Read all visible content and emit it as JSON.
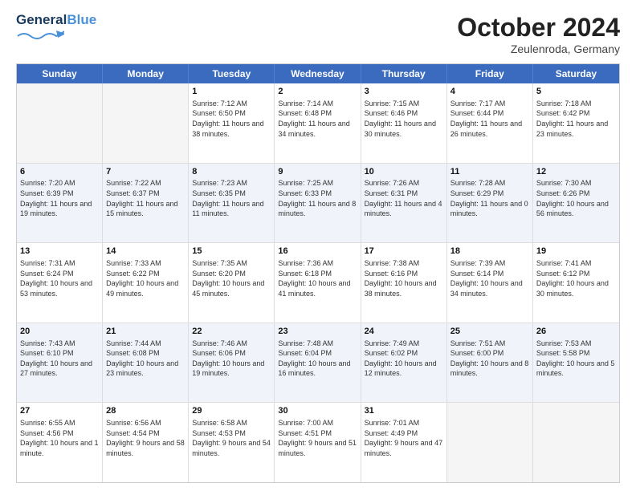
{
  "header": {
    "logo_line1": "General",
    "logo_line2": "Blue",
    "month": "October 2024",
    "location": "Zeulenroda, Germany"
  },
  "days_of_week": [
    "Sunday",
    "Monday",
    "Tuesday",
    "Wednesday",
    "Thursday",
    "Friday",
    "Saturday"
  ],
  "weeks": [
    [
      {
        "day": "",
        "info": ""
      },
      {
        "day": "",
        "info": ""
      },
      {
        "day": "1",
        "info": "Sunrise: 7:12 AM\nSunset: 6:50 PM\nDaylight: 11 hours and 38 minutes."
      },
      {
        "day": "2",
        "info": "Sunrise: 7:14 AM\nSunset: 6:48 PM\nDaylight: 11 hours and 34 minutes."
      },
      {
        "day": "3",
        "info": "Sunrise: 7:15 AM\nSunset: 6:46 PM\nDaylight: 11 hours and 30 minutes."
      },
      {
        "day": "4",
        "info": "Sunrise: 7:17 AM\nSunset: 6:44 PM\nDaylight: 11 hours and 26 minutes."
      },
      {
        "day": "5",
        "info": "Sunrise: 7:18 AM\nSunset: 6:42 PM\nDaylight: 11 hours and 23 minutes."
      }
    ],
    [
      {
        "day": "6",
        "info": "Sunrise: 7:20 AM\nSunset: 6:39 PM\nDaylight: 11 hours and 19 minutes."
      },
      {
        "day": "7",
        "info": "Sunrise: 7:22 AM\nSunset: 6:37 PM\nDaylight: 11 hours and 15 minutes."
      },
      {
        "day": "8",
        "info": "Sunrise: 7:23 AM\nSunset: 6:35 PM\nDaylight: 11 hours and 11 minutes."
      },
      {
        "day": "9",
        "info": "Sunrise: 7:25 AM\nSunset: 6:33 PM\nDaylight: 11 hours and 8 minutes."
      },
      {
        "day": "10",
        "info": "Sunrise: 7:26 AM\nSunset: 6:31 PM\nDaylight: 11 hours and 4 minutes."
      },
      {
        "day": "11",
        "info": "Sunrise: 7:28 AM\nSunset: 6:29 PM\nDaylight: 11 hours and 0 minutes."
      },
      {
        "day": "12",
        "info": "Sunrise: 7:30 AM\nSunset: 6:26 PM\nDaylight: 10 hours and 56 minutes."
      }
    ],
    [
      {
        "day": "13",
        "info": "Sunrise: 7:31 AM\nSunset: 6:24 PM\nDaylight: 10 hours and 53 minutes."
      },
      {
        "day": "14",
        "info": "Sunrise: 7:33 AM\nSunset: 6:22 PM\nDaylight: 10 hours and 49 minutes."
      },
      {
        "day": "15",
        "info": "Sunrise: 7:35 AM\nSunset: 6:20 PM\nDaylight: 10 hours and 45 minutes."
      },
      {
        "day": "16",
        "info": "Sunrise: 7:36 AM\nSunset: 6:18 PM\nDaylight: 10 hours and 41 minutes."
      },
      {
        "day": "17",
        "info": "Sunrise: 7:38 AM\nSunset: 6:16 PM\nDaylight: 10 hours and 38 minutes."
      },
      {
        "day": "18",
        "info": "Sunrise: 7:39 AM\nSunset: 6:14 PM\nDaylight: 10 hours and 34 minutes."
      },
      {
        "day": "19",
        "info": "Sunrise: 7:41 AM\nSunset: 6:12 PM\nDaylight: 10 hours and 30 minutes."
      }
    ],
    [
      {
        "day": "20",
        "info": "Sunrise: 7:43 AM\nSunset: 6:10 PM\nDaylight: 10 hours and 27 minutes."
      },
      {
        "day": "21",
        "info": "Sunrise: 7:44 AM\nSunset: 6:08 PM\nDaylight: 10 hours and 23 minutes."
      },
      {
        "day": "22",
        "info": "Sunrise: 7:46 AM\nSunset: 6:06 PM\nDaylight: 10 hours and 19 minutes."
      },
      {
        "day": "23",
        "info": "Sunrise: 7:48 AM\nSunset: 6:04 PM\nDaylight: 10 hours and 16 minutes."
      },
      {
        "day": "24",
        "info": "Sunrise: 7:49 AM\nSunset: 6:02 PM\nDaylight: 10 hours and 12 minutes."
      },
      {
        "day": "25",
        "info": "Sunrise: 7:51 AM\nSunset: 6:00 PM\nDaylight: 10 hours and 8 minutes."
      },
      {
        "day": "26",
        "info": "Sunrise: 7:53 AM\nSunset: 5:58 PM\nDaylight: 10 hours and 5 minutes."
      }
    ],
    [
      {
        "day": "27",
        "info": "Sunrise: 6:55 AM\nSunset: 4:56 PM\nDaylight: 10 hours and 1 minute."
      },
      {
        "day": "28",
        "info": "Sunrise: 6:56 AM\nSunset: 4:54 PM\nDaylight: 9 hours and 58 minutes."
      },
      {
        "day": "29",
        "info": "Sunrise: 6:58 AM\nSunset: 4:53 PM\nDaylight: 9 hours and 54 minutes."
      },
      {
        "day": "30",
        "info": "Sunrise: 7:00 AM\nSunset: 4:51 PM\nDaylight: 9 hours and 51 minutes."
      },
      {
        "day": "31",
        "info": "Sunrise: 7:01 AM\nSunset: 4:49 PM\nDaylight: 9 hours and 47 minutes."
      },
      {
        "day": "",
        "info": ""
      },
      {
        "day": "",
        "info": ""
      }
    ]
  ]
}
